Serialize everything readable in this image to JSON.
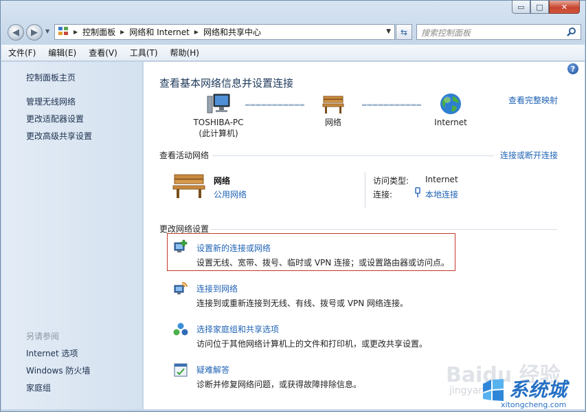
{
  "window": {
    "caption": {
      "minimize": "▭",
      "maximize": "□",
      "close": "✕"
    }
  },
  "address": {
    "crumbs": [
      "控制面板",
      "网络和 Internet",
      "网络和共享中心"
    ],
    "search_placeholder": "搜索控制面板"
  },
  "menu": [
    "文件(F)",
    "编辑(E)",
    "查看(V)",
    "工具(T)",
    "帮助(H)"
  ],
  "sidebar": {
    "home": "控制面板主页",
    "links": [
      "管理无线网络",
      "更改适配器设置",
      "更改高级共享设置"
    ],
    "see_also_heading": "另请参阅",
    "see_also": [
      "Internet 选项",
      "Windows 防火墙",
      "家庭组"
    ]
  },
  "main": {
    "title": "查看基本网络信息并设置连接",
    "full_map_link": "查看完整映射",
    "nodes": [
      {
        "label": "TOSHIBA-PC",
        "sublabel": "(此计算机)",
        "icon": "computer-icon"
      },
      {
        "label": "网络",
        "icon": "bench-network-icon"
      },
      {
        "label": "Internet",
        "icon": "globe-icon"
      }
    ],
    "active_section_title": "查看活动网络",
    "connect_disconnect_link": "连接或断开连接",
    "active_network": {
      "name": "网络",
      "type": "公用网络",
      "access_type_label": "访问类型:",
      "access_type_value": "Internet",
      "connection_label": "连接:",
      "connection_value": "本地连接"
    },
    "change_section_title": "更改网络设置",
    "tasks": [
      {
        "title": "设置新的连接或网络",
        "desc": "设置无线、宽带、拨号、临时或 VPN 连接；或设置路由器或访问点。",
        "icon": "new-connection-icon"
      },
      {
        "title": "连接到网络",
        "desc": "连接到或重新连接到无线、有线、拨号或 VPN 网络连接。",
        "icon": "connect-network-icon"
      },
      {
        "title": "选择家庭组和共享选项",
        "desc": "访问位于其他网络计算机上的文件和打印机，或更改共享设置。",
        "icon": "homegroup-icon"
      },
      {
        "title": "疑难解答",
        "desc": "诊断并修复网络问题，或获得故障排除信息。",
        "icon": "troubleshoot-icon"
      }
    ]
  },
  "watermark": {
    "baidu": "Baidu 经验",
    "baidu_sub": "jingyan",
    "xitong": "系统城",
    "xitong_url": "xitongcheng.com"
  },
  "colors": {
    "link": "#1f63b5",
    "title": "#1e395b",
    "highlight": "#c0392b"
  }
}
